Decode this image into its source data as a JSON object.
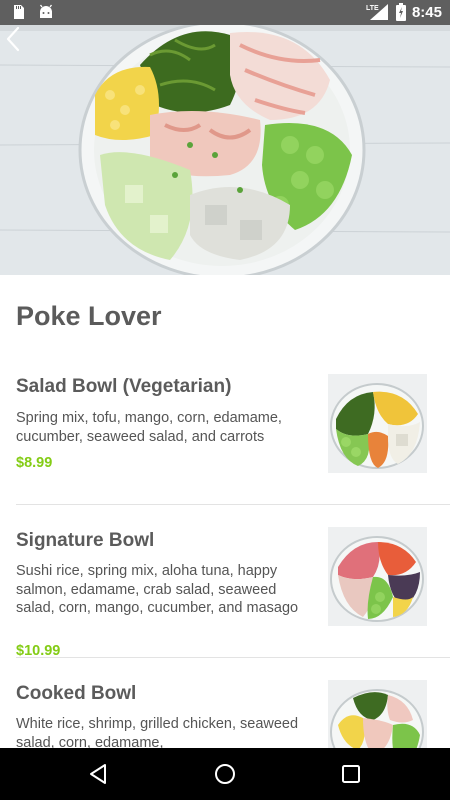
{
  "status_bar": {
    "time": "8:45",
    "network": "LTE",
    "icons": [
      "sd-card-icon",
      "android-icon",
      "signal-icon",
      "battery-icon"
    ]
  },
  "header": {
    "back_icon": "chevron-left-icon"
  },
  "page": {
    "title": "Poke Lover"
  },
  "menu_items": [
    {
      "name": "Salad Bowl (Vegetarian)",
      "description": "Spring mix, tofu, mango, corn, edamame, cucumber, seaweed salad, and carrots",
      "price": "$8.99"
    },
    {
      "name": "Signature Bowl",
      "description": "Sushi rice, spring mix, aloha tuna, happy salmon, edamame, crab salad, seaweed salad, corn, mango, cucumber, and masago",
      "price": "$10.99"
    },
    {
      "name": "Cooked Bowl",
      "description": "White rice, shrimp, grilled chicken, seaweed salad, corn, edamame,",
      "price": ""
    }
  ],
  "nav_bar": {
    "icons": [
      "back-triangle-icon",
      "home-circle-icon",
      "recents-square-icon"
    ]
  },
  "colors": {
    "price_green": "#84cc16",
    "status_bar": "#5f5f5f",
    "title_gray": "#5b5b5b"
  }
}
